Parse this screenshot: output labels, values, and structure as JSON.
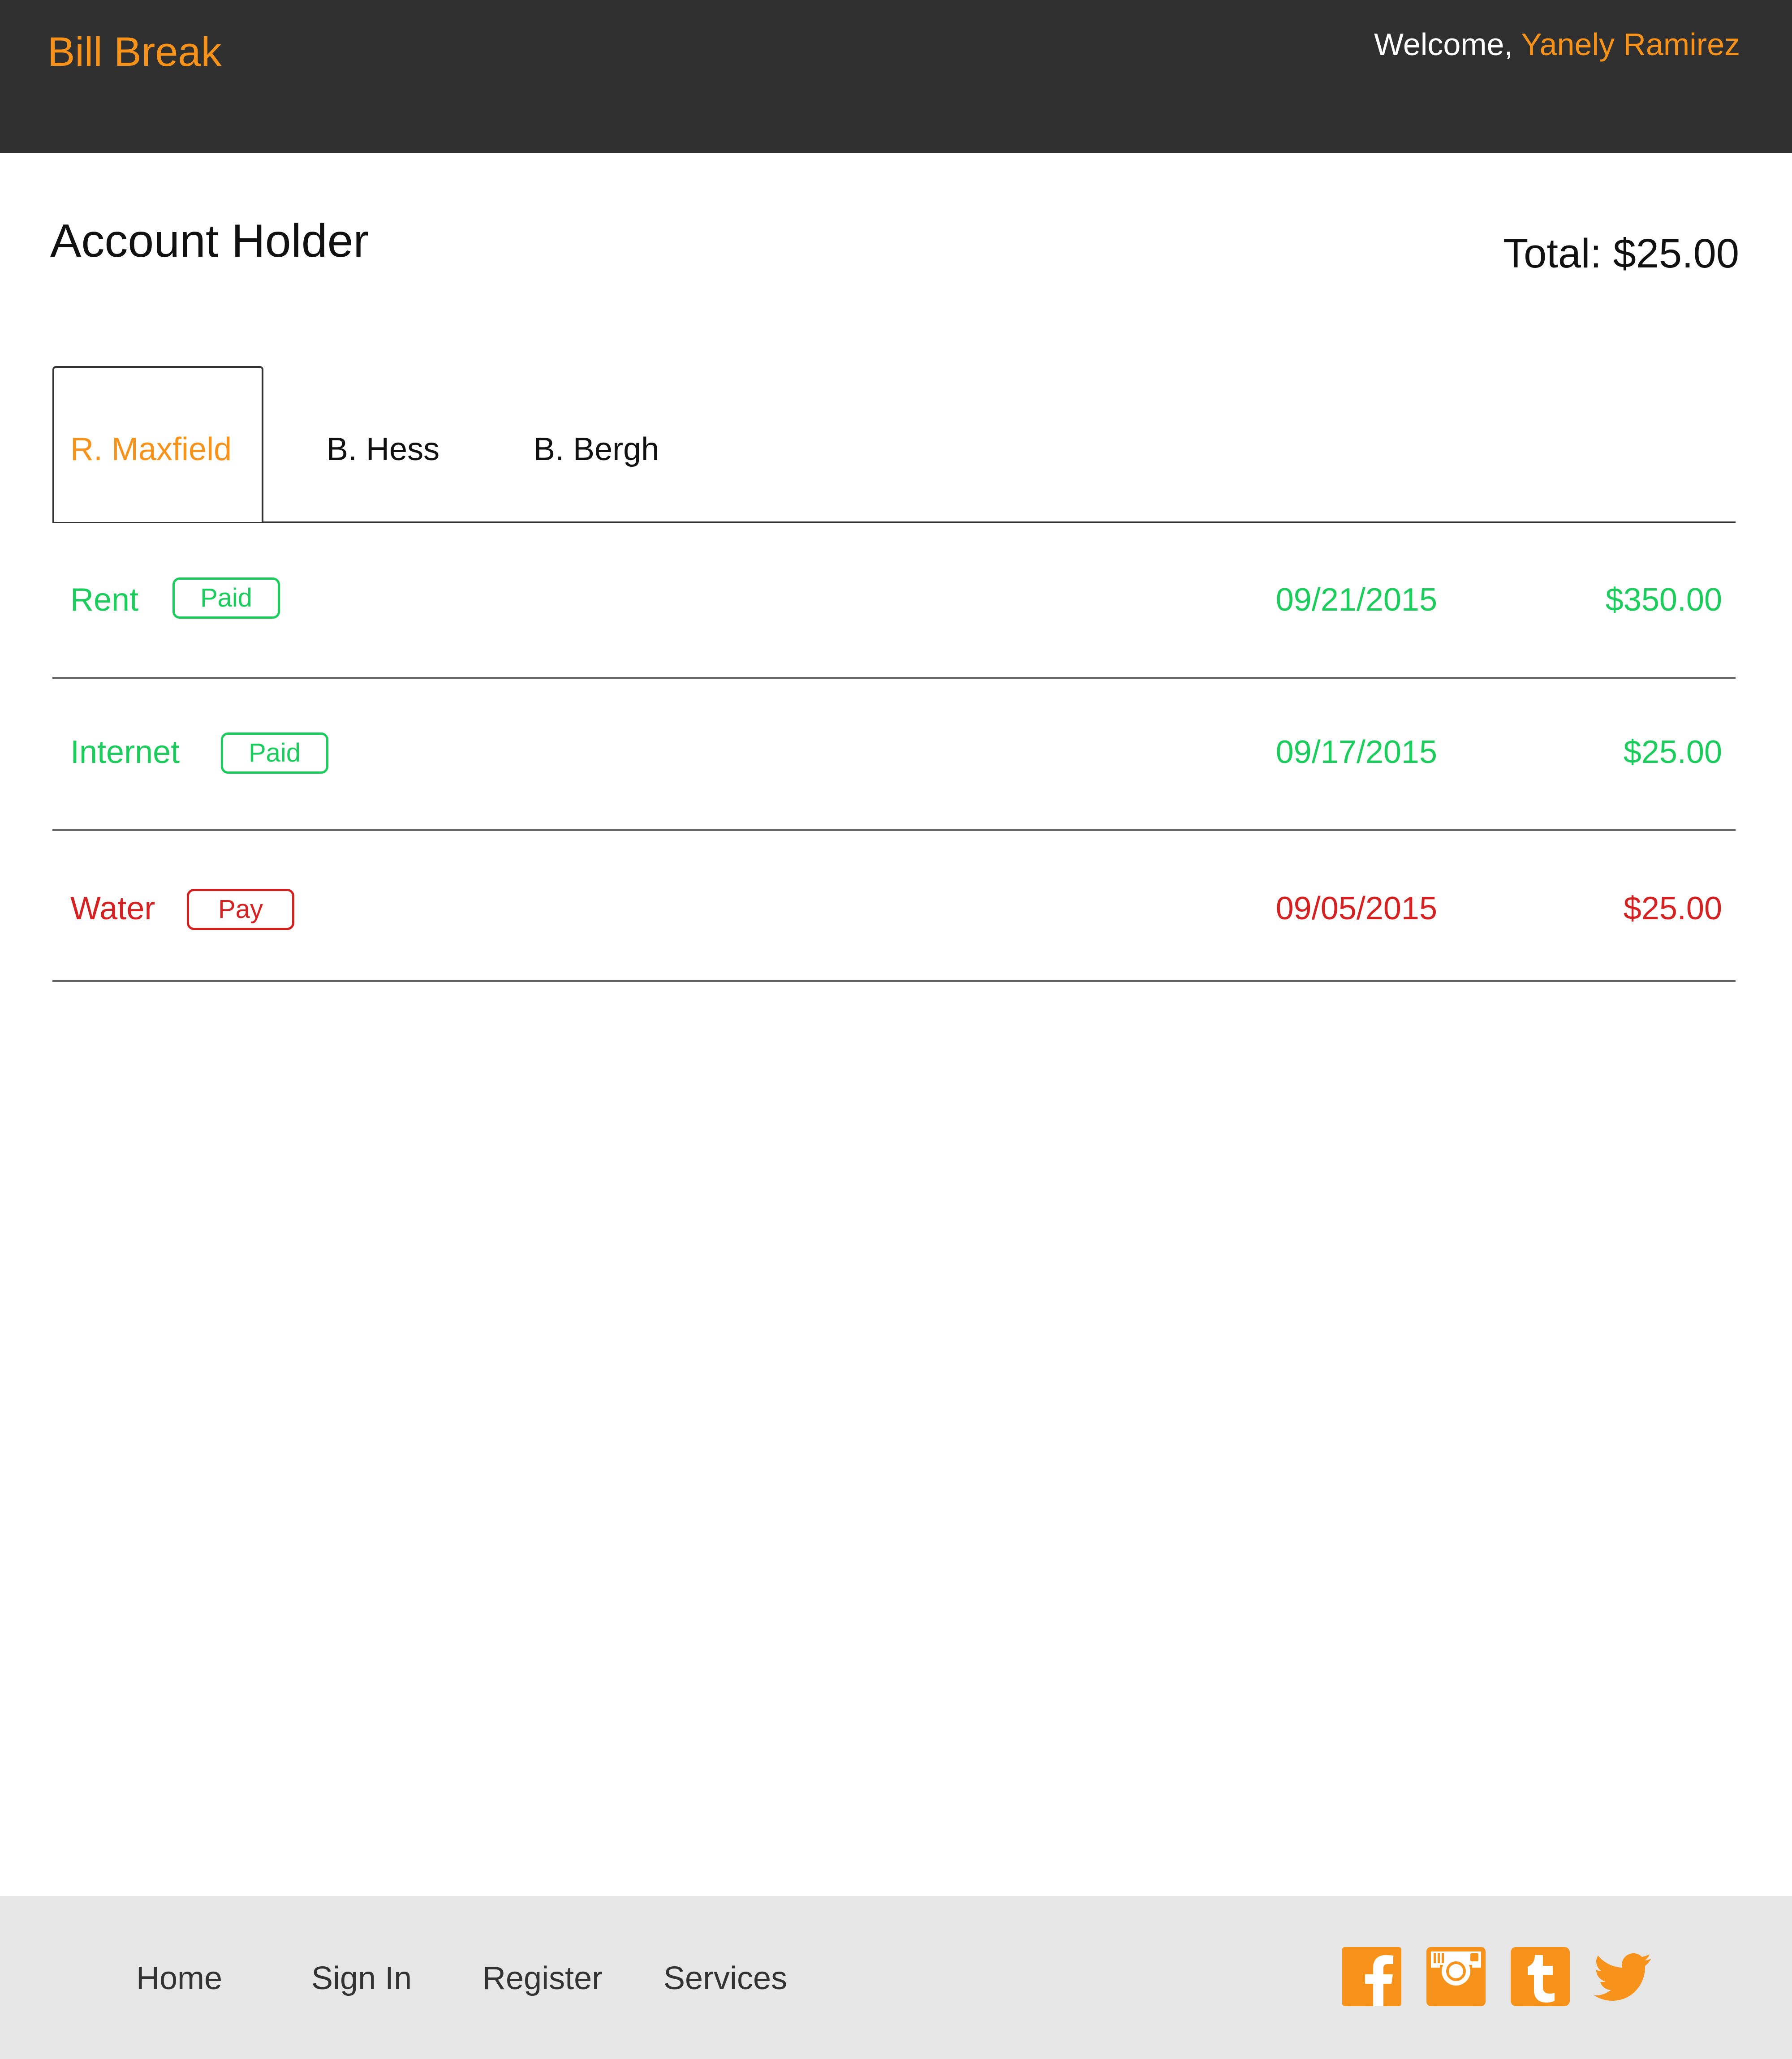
{
  "header": {
    "brand": "Bill Break",
    "welcome_prefix": "Welcome, ",
    "user_name": "Yanely Ramirez"
  },
  "main": {
    "title": "Account Holder",
    "total": "Total: $25.00",
    "tabs": [
      {
        "label": "R. Maxfield",
        "active": true
      },
      {
        "label": "B. Hess",
        "active": false
      },
      {
        "label": "B. Bergh",
        "active": false
      }
    ],
    "bills": [
      {
        "name": "Rent",
        "status": "Paid",
        "date": "09/21/2015",
        "amount": "$350.00"
      },
      {
        "name": "Internet",
        "status": "Paid",
        "date": "09/17/2015",
        "amount": "$25.00"
      },
      {
        "name": "Water",
        "status": "Pay",
        "date": "09/05/2015",
        "amount": "$25.00"
      }
    ]
  },
  "footer": {
    "nav": [
      "Home",
      "Sign In",
      "Register",
      "Services"
    ],
    "social": [
      "facebook-icon",
      "instagram-icon",
      "tumblr-icon",
      "twitter-icon"
    ]
  },
  "colors": {
    "accent": "#f7931a",
    "header_bg": "#303030",
    "footer_bg": "#e6e6e6",
    "paid": "#1ccc5c",
    "due": "#d42222"
  }
}
